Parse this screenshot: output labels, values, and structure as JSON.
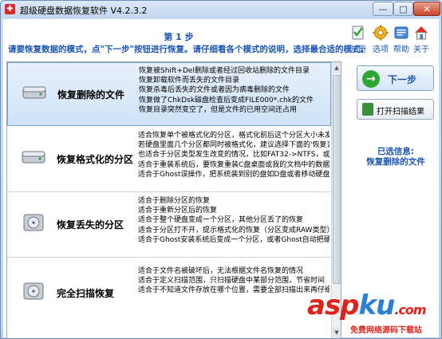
{
  "window": {
    "title": "超级硬盘数据恢复软件 V4.2.3.2",
    "min": "—",
    "max": "□",
    "close": "✕"
  },
  "header": {
    "step": "第 1 步",
    "instruction": "请要恢复数据的模式，点\"下一步\"按钮进行恢复。请仔细看各个模式的说明，选择最合适的模式。"
  },
  "toolbar": [
    {
      "label": "注册",
      "icon": "register-icon"
    },
    {
      "label": "选项",
      "icon": "options-gear-icon"
    },
    {
      "label": "帮助",
      "icon": "help-icon"
    },
    {
      "label": "关于",
      "icon": "about-home-icon"
    }
  ],
  "options": [
    {
      "label": "恢复删除的文件",
      "selected": true,
      "lines": [
        "恢复被Shift+Del删除或者经过回收站删除的文件目录",
        "恢复卸载软件而丢失的文件目录",
        "恢复杀毒后丢失的文件或者因为病毒删除的文件",
        "恢复做了ChkDsk磁盘检查后变成FILE000*.chk的文件",
        "恢复目录突然变空了，但是文件的已用空间还占用"
      ]
    },
    {
      "label": "恢复格式化的分区",
      "selected": false,
      "lines": [
        "适合恢复单个被格式化的分区，格式化前后这个分区大小未发生",
        "若硬盘里面几个分区都同时被格式化，建议选择下面的'恢复丢失的",
        "也适合于分区类型发生改变的情况，比如FAT32->NTFS，或者NT",
        "适合于重装系统后，要恢复重装C盘桌面或我的文档中的数据",
        "适合于Ghost误操作，把系统装到别的盘如D盘或者移动硬盘"
      ]
    },
    {
      "label": "恢复丢失的分区",
      "selected": false,
      "lines": [
        "适合于删除分区的恢复",
        "适合于重新分区后的恢复",
        "适合于整个硬盘变成一个分区，其他分区丢了的恢复",
        "适合于分区打不开，提示格式化的恢复（分区变成RAW类型）",
        "适合于Ghost安装系统后变成一个分区，或者Ghost自动把硬盘分"
      ]
    },
    {
      "label": "完全扫描恢复",
      "selected": false,
      "lines": [
        "适合于文件名被破坏后，无法根据文件名恢复的情况",
        "适合于定义扫描范围，只扫描硬盘中某部分范围，节省时间",
        "适合于不知道文件存放在哪个位置，需要全部扫描出来再仔细查"
      ]
    }
  ],
  "scrollbar": {
    "up": "▲",
    "down": "▼"
  },
  "side": {
    "next_label": "下一步",
    "next_arrow": "→",
    "open_scan_label": "打开扫描结果",
    "selected_info_title": "已选信息:",
    "selected_info_value": "恢复删除的文件"
  },
  "watermark": {
    "brand_a": "asp",
    "brand_b": "ku",
    "brand_c": ".com",
    "sub": "免费网络源码下载站"
  },
  "colors": {
    "accent": "#1a55b8",
    "next_arrow": "#2ea632",
    "watermark": "#e0231a"
  }
}
